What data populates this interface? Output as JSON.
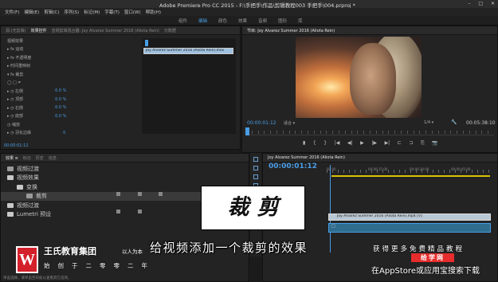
{
  "window": {
    "title": "Adobe Premiere Pro CC 2015 - F:\\手把手\\作品\\剪辑教程003 手把手\\004.prproj *",
    "controls": [
      "–",
      "□",
      "✕"
    ]
  },
  "menubar": [
    "文件(F)",
    "编辑(E)",
    "剪辑(C)",
    "序列(S)",
    "标记(M)",
    "字幕(T)",
    "窗口(W)",
    "帮助(H)"
  ],
  "workspace_tabs": [
    "组件",
    "编辑",
    "颜色",
    "效果",
    "音频",
    "图形",
    "库"
  ],
  "effect_controls": {
    "tabs": [
      "源:(无剪辑)",
      "效果控件",
      "音频剪辑混合器: Joy Alvarez Summer 2016 (Aliota Rein)",
      "元数据"
    ],
    "clip_label": "Joy Alvarez Summer 2016 (Aliota Rein).mov",
    "rows": [
      {
        "label": "视频效果",
        "value": ""
      },
      {
        "label": "▸ fx  运动",
        "value": ""
      },
      {
        "label": "▸ fx  不透明度",
        "value": ""
      },
      {
        "label": "▸    时间重映射",
        "value": ""
      },
      {
        "label": "▾ fx  裁剪",
        "value": ""
      },
      {
        "label": "      ◯ □ ✒",
        "value": ""
      },
      {
        "label": "▸ ◷ 左侧",
        "value": "0.0 %"
      },
      {
        "label": "▸ ◷ 顶部",
        "value": "0.0 %"
      },
      {
        "label": "▸ ◷ 右侧",
        "value": "0.0 %"
      },
      {
        "label": "▸ ◷ 底部",
        "value": "0.0 %"
      },
      {
        "label": "    ◷                    缩放",
        "value": ""
      },
      {
        "label": "▸ ◷ 羽化边缘",
        "value": "0"
      }
    ],
    "timecode": "00:00:01:12"
  },
  "program_monitor": {
    "tab": "节目: Joy Alvarez Summer 2016 (Aliota Rein)",
    "timecode_left": "00:00:01:12",
    "fit": "适合",
    "quality": "1/4",
    "timecode_right": "00:05:38:10",
    "controls": [
      "▮",
      "{",
      "}",
      "|◀",
      "◀|",
      "▶",
      "|▶",
      "▶|",
      "⊏",
      "⊐",
      "⎘",
      "📷"
    ]
  },
  "project": {
    "tabs": [
      "效果 ≡",
      "标记",
      "历史",
      "信息"
    ],
    "items": [
      {
        "label": "视频过渡",
        "indent": 1
      },
      {
        "label": "视频效果",
        "indent": 1
      },
      {
        "label": "变换",
        "indent": 2
      },
      {
        "label": "裁剪",
        "indent": 3
      },
      {
        "label": "视频过渡",
        "indent": 1
      },
      {
        "label": "Lumetri 预设",
        "indent": 1
      }
    ],
    "status": "单击选择，或单击空白处以查看其它选项。"
  },
  "timeline": {
    "tab": "Joy Alvarez Summer 2016 (Aliota Rein)",
    "timecode": "00:00:01:12",
    "ruler": [
      "00:00",
      "00:00:15:00",
      "00:00:30:00",
      "00:00:45:00"
    ],
    "video_clip": "Joy Alvarez Summer 2016 (Aliota Rein).mp4 [V]",
    "audio_clip": "□"
  },
  "overlay": {
    "caption": "裁剪",
    "subtitle": "给视频添加一个裁剪的效果",
    "logo_letter": "W",
    "brand_name": "王氏教育集团",
    "brand_slogan": "以人为本",
    "brand_tagline": "始创于二零零二年",
    "promo_line1": "获得更多免费精品教程",
    "promo_badge": "给学网",
    "promo_line2": "在AppStore或应用宝搜索下载"
  },
  "colors": {
    "accent": "#4a9de5",
    "timeline_in_out": "#d9c300",
    "logo_red": "#d4202a"
  }
}
